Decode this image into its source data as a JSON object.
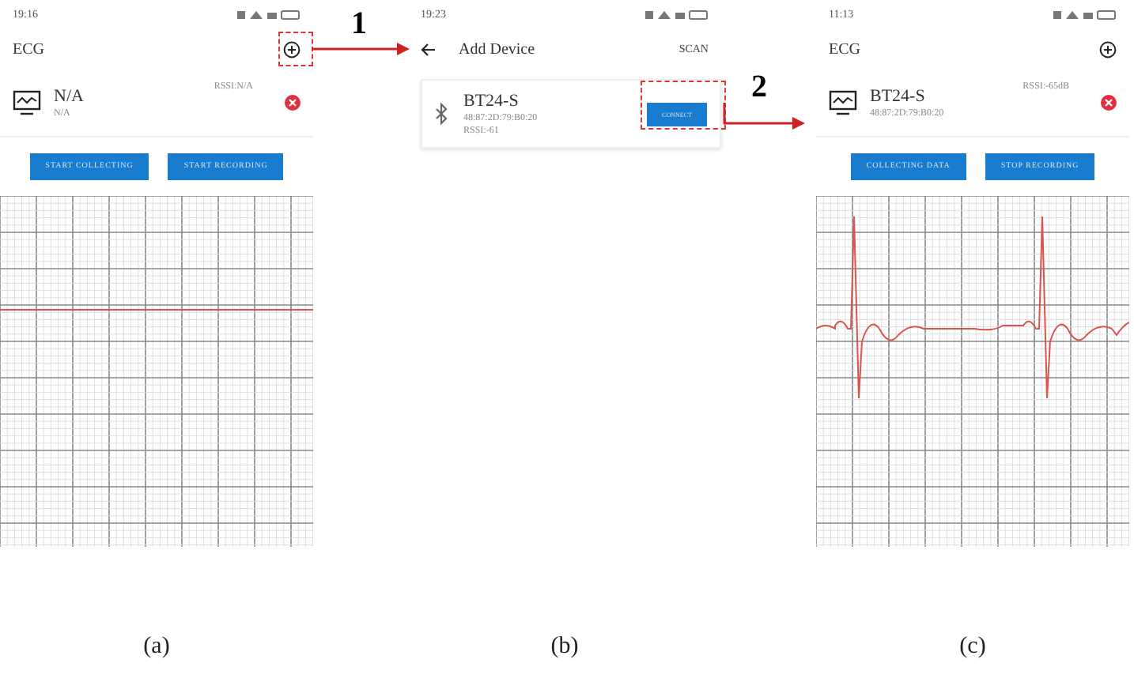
{
  "screens": [
    {
      "kind": "main",
      "status_time": "19:16",
      "title": "ECG",
      "device": {
        "name": "N/A",
        "address": "N/A",
        "rssi": "RSSI:N/A"
      },
      "buttons": [
        "START COLLECTING",
        "START RECORDING"
      ],
      "receiving": false
    },
    {
      "kind": "scan",
      "status_time": "19:23",
      "title": "Add Device",
      "action": "SCAN",
      "devices": [
        {
          "name": "BT24-S",
          "address": "48:87:2D:79:B0:20",
          "rssi": "RSSI:-61",
          "button": "CONNECT"
        }
      ]
    },
    {
      "kind": "main",
      "status_time": "11:13",
      "title": "ECG",
      "device": {
        "name": "BT24-S",
        "address": "48:87:2D:79:B0:20",
        "rssi": "RSSI:-65dB"
      },
      "buttons": [
        "COLLECTING DATA",
        "STOP RECORDING"
      ],
      "receiving": true
    }
  ],
  "step_labels": [
    "1",
    "2"
  ],
  "captions": [
    "(a)",
    "(b)",
    "(c)"
  ]
}
